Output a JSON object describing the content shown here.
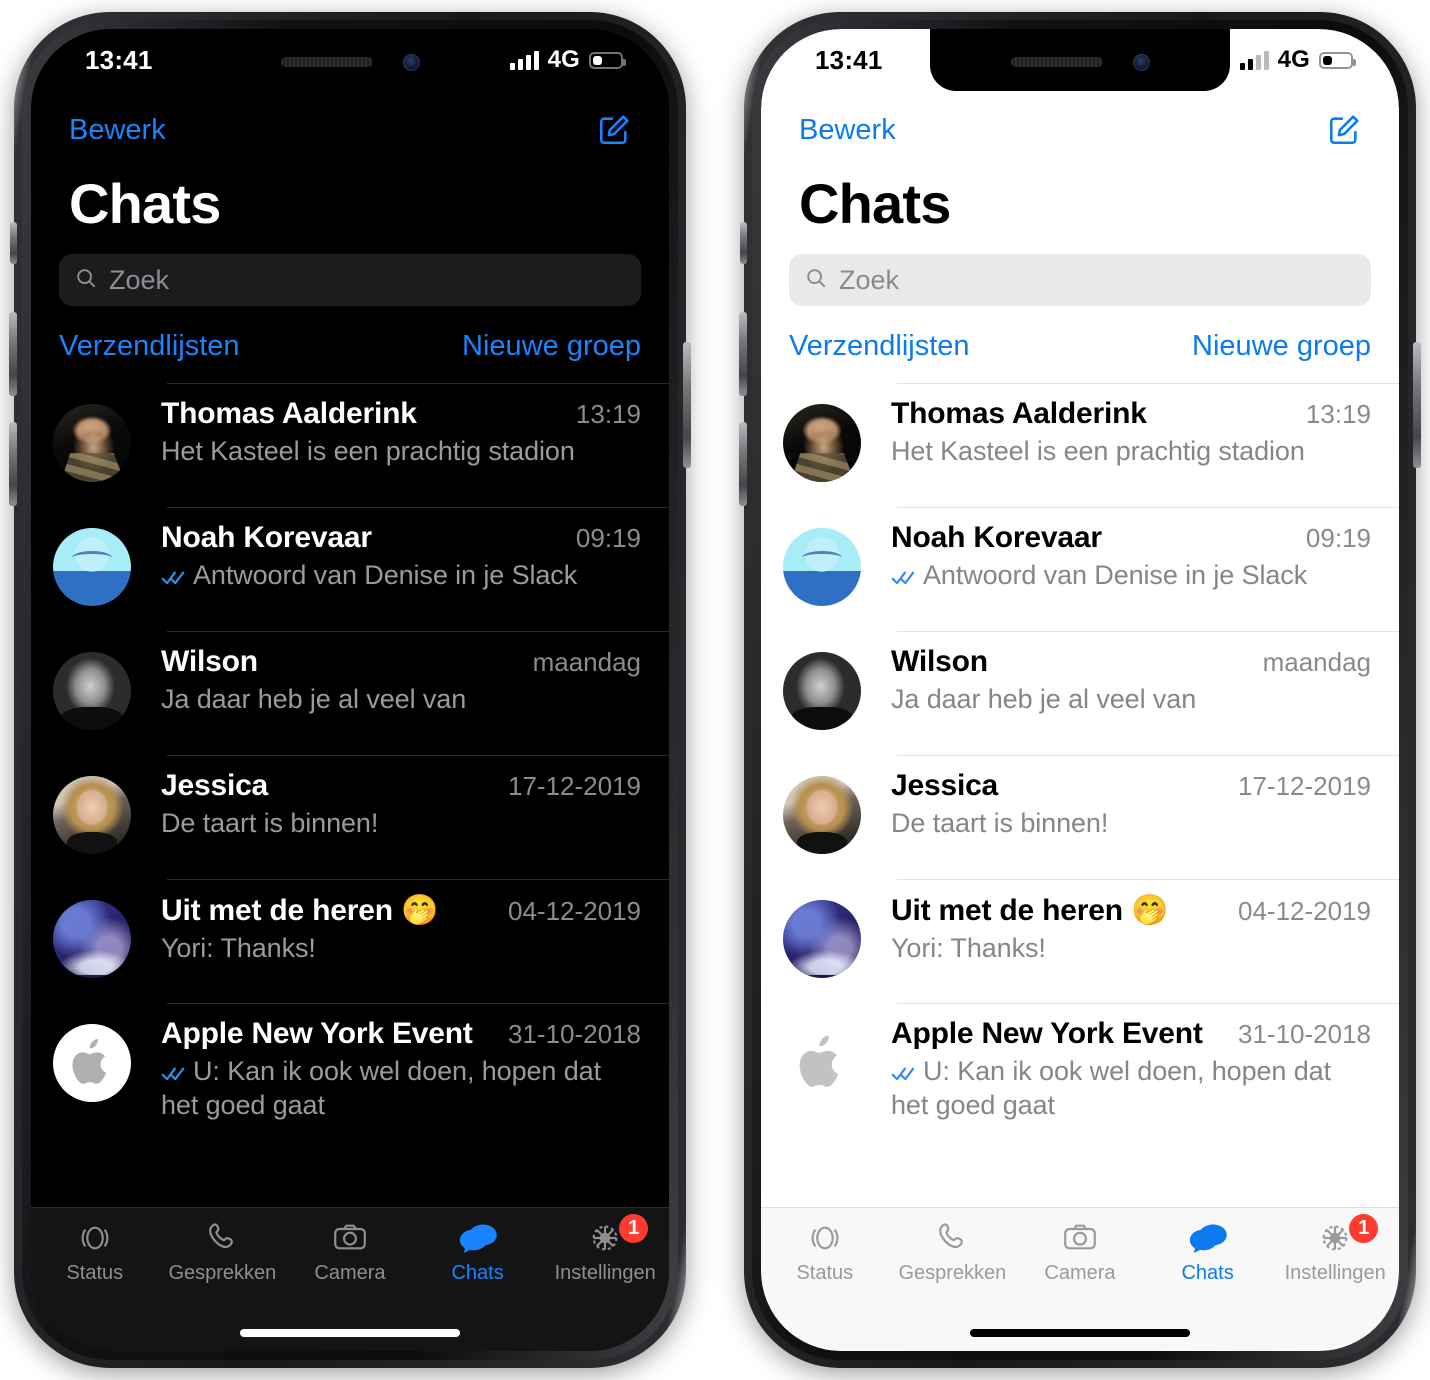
{
  "status_bar": {
    "time": "13:41",
    "network": "4G",
    "signal_bars_total": 4,
    "signal_bars_filled": 2,
    "battery_percent_visual": 34
  },
  "nav": {
    "edit_label": "Bewerk",
    "compose_icon": "compose-icon"
  },
  "header": {
    "title": "Chats"
  },
  "search": {
    "placeholder": "Zoek",
    "icon": "search-icon"
  },
  "list_actions": {
    "left_label": "Verzendlijsten",
    "right_label": "Nieuwe groep"
  },
  "chats": [
    {
      "name": "Thomas Aalderink",
      "time": "13:19",
      "message": "Het Kasteel is een prachtig stadion",
      "ticks": false,
      "avatar": "thomas-avatar"
    },
    {
      "name": "Noah Korevaar",
      "time": "09:19",
      "message": "Antwoord van Denise in je Slack",
      "ticks": true,
      "avatar": "noah-avatar"
    },
    {
      "name": "Wilson",
      "time": "maandag",
      "message": "Ja daar heb je al veel van",
      "ticks": false,
      "avatar": "wilson-avatar"
    },
    {
      "name": "Jessica",
      "time": "17-12-2019",
      "message": "De taart is binnen!",
      "ticks": false,
      "avatar": "jessica-avatar"
    },
    {
      "name": "Uit met de heren 🤭",
      "time": "04-12-2019",
      "message": "Yori: Thanks!",
      "ticks": false,
      "avatar": "uit-met-de-heren-avatar"
    },
    {
      "name": "Apple New York Event",
      "time": "31-10-2018",
      "message": "U: Kan ik ook wel doen, hopen dat het goed gaat",
      "ticks": true,
      "avatar": "apple-avatar"
    }
  ],
  "tabs": [
    {
      "label": "Status",
      "icon": "status-icon",
      "active": false,
      "badge": ""
    },
    {
      "label": "Gesprekken",
      "icon": "phone-icon",
      "active": false,
      "badge": ""
    },
    {
      "label": "Camera",
      "icon": "camera-icon",
      "active": false,
      "badge": ""
    },
    {
      "label": "Chats",
      "icon": "chats-icon",
      "active": true,
      "badge": ""
    },
    {
      "label": "Instellingen",
      "icon": "gear-icon",
      "active": false,
      "badge": "1"
    }
  ],
  "colors": {
    "accent_dark": "#1A84FF",
    "accent_light": "#0B7BEF",
    "badge_red": "#FF3B30",
    "tick_blue": "#2F8EF0",
    "dark_bg": "#000000",
    "light_bg": "#FFFFFF",
    "dark_search_bg": "#1C1C1E",
    "light_search_bg": "#E9E9EA",
    "dark_secondary_text": "#9A9A9F",
    "light_secondary_text": "#86868A"
  }
}
